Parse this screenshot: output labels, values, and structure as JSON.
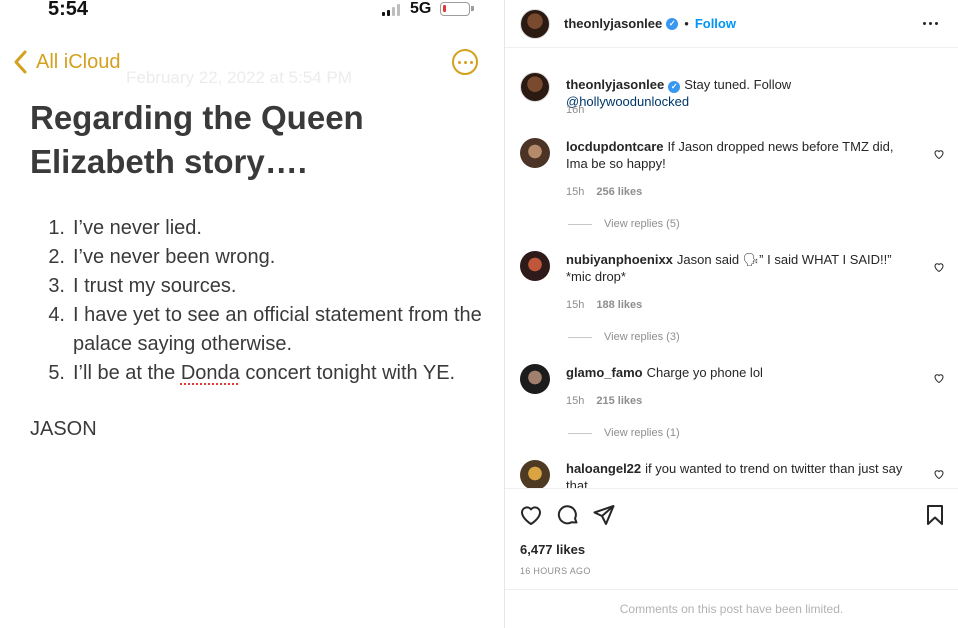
{
  "status_bar": {
    "time": "5:54",
    "network": "5G"
  },
  "notes": {
    "back_label": "All iCloud",
    "faded_date": "February 22, 2022 at 5:54 PM",
    "title": "Regarding the Queen Elizabeth story….",
    "items": [
      {
        "num": "1.",
        "pre": "I’ve never lied.",
        "flag": "",
        "post": ""
      },
      {
        "num": "2.",
        "pre": "I’ve never been wrong.",
        "flag": "",
        "post": ""
      },
      {
        "num": "3.",
        "pre": "I trust my sources.",
        "flag": "",
        "post": ""
      },
      {
        "num": "4.",
        "pre": "I have yet to see an official statement from the palace saying otherwise.",
        "flag": "",
        "post": ""
      },
      {
        "num": "5.",
        "pre": "I’ll be at the ",
        "flag": "Donda",
        "post": " concert tonight with YE."
      }
    ],
    "signature": "JASON",
    "accent_color": "#d4a11e"
  },
  "instagram": {
    "header": {
      "username": "theonlyjasonlee",
      "dot": "•",
      "follow_label": "Follow"
    },
    "caption": {
      "username": "theonlyjasonlee",
      "text": "Stay tuned. Follow ",
      "mention": "@hollywoodunlocked",
      "time": "16h"
    },
    "comments": [
      {
        "username": "locdupdontcare",
        "text": "If Jason dropped news before TMZ did, Ima be so happy!",
        "time": "15h",
        "likes": "256 likes",
        "replies": "View replies (5)"
      },
      {
        "username": "nubiyanphoenixx",
        "text": "Jason said 🗣” I said WHAT I SAID!!” *mic drop*",
        "time": "15h",
        "likes": "188 likes",
        "replies": "View replies (3)"
      },
      {
        "username": "glamo_famo",
        "text": "Charge yo phone lol",
        "time": "15h",
        "likes": "215 likes",
        "replies": "View replies (1)"
      },
      {
        "username": "haloangel22",
        "text": "if you wanted to trend on twitter than just say that",
        "time": "",
        "likes": "",
        "replies": ""
      }
    ],
    "like_count": "6,477 likes",
    "posted_ago": "16 HOURS AGO",
    "limited_notice": "Comments on this post have been limited."
  }
}
